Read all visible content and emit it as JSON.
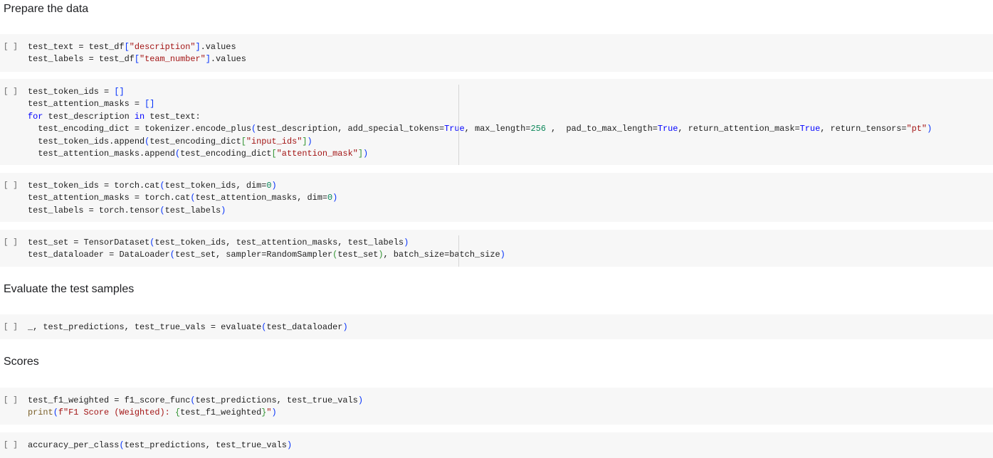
{
  "notebook": {
    "run_label": "[ ]",
    "headings": {
      "prepare": "Prepare the data",
      "evaluate": "Evaluate the test samples",
      "scores": "Scores"
    },
    "cells": [
      {
        "lines": [
          [
            [
              "",
              "test_text = test_df"
            ],
            [
              "brk",
              "["
            ],
            [
              "str",
              "\"description\""
            ],
            [
              "brk",
              "]"
            ],
            [
              "",
              ".values"
            ]
          ],
          [
            [
              "",
              "test_labels = test_df"
            ],
            [
              "brk",
              "["
            ],
            [
              "str",
              "\"team_number\""
            ],
            [
              "brk",
              "]"
            ],
            [
              "",
              ".values"
            ]
          ]
        ]
      },
      {
        "lines": [
          [
            [
              "",
              "test_token_ids = "
            ],
            [
              "brk",
              "[]"
            ]
          ],
          [
            [
              "",
              "test_attention_masks = "
            ],
            [
              "brk",
              "[]"
            ]
          ],
          [
            [
              "kw",
              "for"
            ],
            [
              "",
              " test_description "
            ],
            [
              "kw",
              "in"
            ],
            [
              "",
              " test_text:"
            ]
          ],
          [
            [
              "",
              "  test_encoding_dict = tokenizer.encode_plus"
            ],
            [
              "brk",
              "("
            ],
            [
              "",
              "test_description, add_special_tokens="
            ],
            [
              "kw",
              "True"
            ],
            [
              "",
              ", max_length="
            ],
            [
              "num",
              "256"
            ],
            [
              "",
              " ,  pad_to_max_length="
            ],
            [
              "kw",
              "True"
            ],
            [
              "",
              ", return_attention_mask="
            ],
            [
              "kw",
              "True"
            ],
            [
              "",
              ", return_tensors="
            ],
            [
              "str",
              "\"pt\""
            ],
            [
              "brk",
              ")"
            ]
          ],
          [
            [
              "",
              "  test_token_ids.append"
            ],
            [
              "brk",
              "("
            ],
            [
              "",
              "test_encoding_dict"
            ],
            [
              "brk2",
              "["
            ],
            [
              "str",
              "\"input_ids\""
            ],
            [
              "brk2",
              "]"
            ],
            [
              "brk",
              ")"
            ]
          ],
          [
            [
              "",
              "  test_attention_masks.append"
            ],
            [
              "brk",
              "("
            ],
            [
              "",
              "test_encoding_dict"
            ],
            [
              "brk2",
              "["
            ],
            [
              "str",
              "\"attention_mask\""
            ],
            [
              "brk2",
              "]"
            ],
            [
              "brk",
              ")"
            ]
          ]
        ]
      },
      {
        "lines": [
          [
            [
              "",
              "test_token_ids = torch.cat"
            ],
            [
              "brk",
              "("
            ],
            [
              "",
              "test_token_ids, dim="
            ],
            [
              "num",
              "0"
            ],
            [
              "brk",
              ")"
            ]
          ],
          [
            [
              "",
              "test_attention_masks = torch.cat"
            ],
            [
              "brk",
              "("
            ],
            [
              "",
              "test_attention_masks, dim="
            ],
            [
              "num",
              "0"
            ],
            [
              "brk",
              ")"
            ]
          ],
          [
            [
              "",
              "test_labels = torch.tensor"
            ],
            [
              "brk",
              "("
            ],
            [
              "",
              "test_labels"
            ],
            [
              "brk",
              ")"
            ]
          ]
        ]
      },
      {
        "lines": [
          [
            [
              "",
              "test_set = TensorDataset"
            ],
            [
              "brk",
              "("
            ],
            [
              "",
              "test_token_ids, test_attention_masks, test_labels"
            ],
            [
              "brk",
              ")"
            ]
          ],
          [
            [
              "",
              "test_dataloader = DataLoader"
            ],
            [
              "brk",
              "("
            ],
            [
              "",
              "test_set, sampler=RandomSampler"
            ],
            [
              "brk2",
              "("
            ],
            [
              "",
              "test_set"
            ],
            [
              "brk2",
              ")"
            ],
            [
              "",
              ", batch_size=batch_size"
            ],
            [
              "brk",
              ")"
            ]
          ]
        ]
      },
      {
        "lines": [
          [
            [
              "",
              "_, test_predictions, test_true_vals = evaluate"
            ],
            [
              "brk",
              "("
            ],
            [
              "",
              "test_dataloader"
            ],
            [
              "brk",
              ")"
            ]
          ]
        ]
      },
      {
        "lines": [
          [
            [
              "",
              "test_f1_weighted = f1_score_func"
            ],
            [
              "brk",
              "("
            ],
            [
              "",
              "test_predictions, test_true_vals"
            ],
            [
              "brk",
              ")"
            ]
          ],
          [
            [
              "fn",
              "print"
            ],
            [
              "brk",
              "("
            ],
            [
              "str",
              "f\"F1 Score (Weighted): "
            ],
            [
              "brk2",
              "{"
            ],
            [
              "",
              "test_f1_weighted"
            ],
            [
              "brk2",
              "}"
            ],
            [
              "str",
              "\""
            ],
            [
              "brk",
              ")"
            ]
          ]
        ]
      },
      {
        "lines": [
          [
            [
              "",
              "accuracy_per_class"
            ],
            [
              "brk",
              "("
            ],
            [
              "",
              "test_predictions, test_true_vals"
            ],
            [
              "brk",
              ")"
            ]
          ]
        ]
      }
    ]
  }
}
